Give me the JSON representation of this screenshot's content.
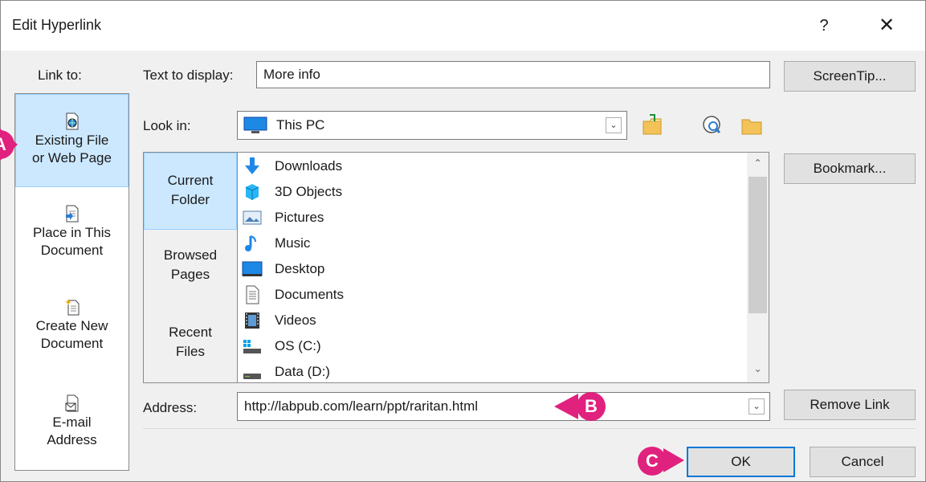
{
  "dialog": {
    "title": "Edit Hyperlink",
    "help_label": "?",
    "close_label": "✕"
  },
  "link_to": {
    "heading": "Link to:",
    "items": [
      {
        "line1": "Existing File",
        "line2": "or Web Page",
        "icon": "web-file-icon",
        "selected": true
      },
      {
        "line1": "Place in This",
        "line2": "Document",
        "icon": "place-in-document-icon",
        "selected": false
      },
      {
        "line1": "Create New",
        "line2": "Document",
        "icon": "new-document-icon",
        "selected": false
      },
      {
        "line1": "E-mail",
        "line2": "Address",
        "icon": "email-address-icon",
        "selected": false
      }
    ]
  },
  "text_to_display": {
    "label": "Text to display:",
    "value": "More info"
  },
  "screentip_button": "ScreenTip...",
  "look_in": {
    "label": "Look in:",
    "value": "This PC"
  },
  "tabs": [
    {
      "line1": "Current",
      "line2": "Folder",
      "selected": true
    },
    {
      "line1": "Browsed",
      "line2": "Pages",
      "selected": false
    },
    {
      "line1": "Recent",
      "line2": "Files",
      "selected": false
    }
  ],
  "files": [
    {
      "name": "Downloads",
      "icon": "downloads-icon"
    },
    {
      "name": "3D Objects",
      "icon": "3d-objects-icon"
    },
    {
      "name": "Pictures",
      "icon": "pictures-icon"
    },
    {
      "name": "Music",
      "icon": "music-icon"
    },
    {
      "name": "Desktop",
      "icon": "desktop-icon"
    },
    {
      "name": "Documents",
      "icon": "documents-icon"
    },
    {
      "name": "Videos",
      "icon": "videos-icon"
    },
    {
      "name": "OS (C:)",
      "icon": "drive-icon"
    },
    {
      "name": "Data (D:)",
      "icon": "drive-icon"
    }
  ],
  "bookmark_button": "Bookmark...",
  "address": {
    "label": "Address:",
    "value": "http://labpub.com/learn/ppt/raritan.html"
  },
  "remove_link_button": "Remove Link",
  "ok_button": "OK",
  "cancel_button": "Cancel",
  "callouts": {
    "a": "A",
    "b": "B",
    "c": "C"
  },
  "colors": {
    "accent": "#0078d7",
    "selection": "#cce8ff",
    "callout": "#e0217e"
  }
}
